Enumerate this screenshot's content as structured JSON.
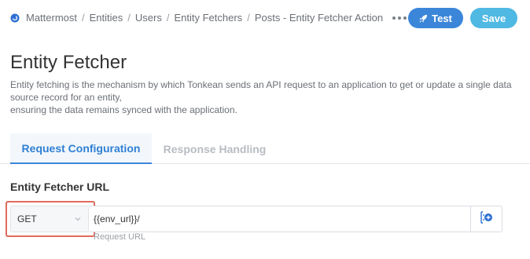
{
  "breadcrumb": {
    "items": [
      "Mattermost",
      "Entities",
      "Users",
      "Entity Fetchers",
      "Posts - Entity Fetcher Action"
    ],
    "separator": "/",
    "more_icon": "more-horizontal-icon"
  },
  "toolbar": {
    "test_label": "Test",
    "save_label": "Save",
    "test_icon": "rocket-icon",
    "test_color": "#3b86d9",
    "save_color": "#4fb8e3"
  },
  "page": {
    "title": "Entity Fetcher",
    "description_line1": "Entity fetching is the mechanism by which Tonkean sends an API request to an application to get or update a single data source record for an entity,",
    "description_line2": "ensuring the data remains synced with the application."
  },
  "tabs": [
    {
      "label": "Request Configuration",
      "active": true
    },
    {
      "label": "Response Handling",
      "active": false
    }
  ],
  "request": {
    "section_label": "Entity Fetcher URL",
    "method": "GET",
    "url_value": "{{env_url}}/",
    "url_hint": "Request URL",
    "insert_icon": "insert-variable-icon",
    "highlight_color": "#e06a5c"
  }
}
